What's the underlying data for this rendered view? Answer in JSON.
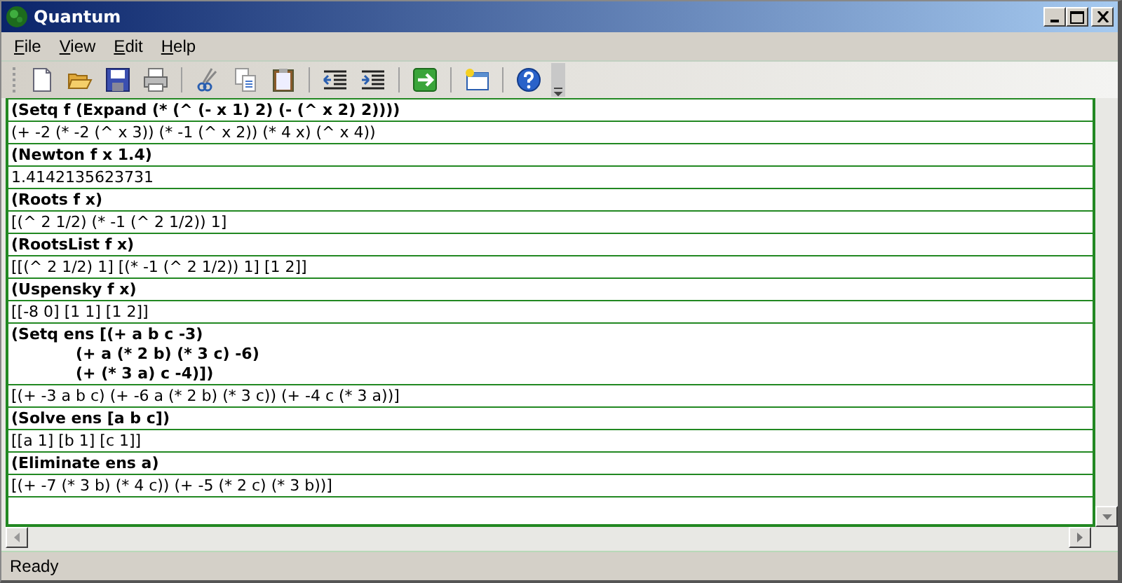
{
  "window": {
    "title": "Quantum"
  },
  "menu": [
    "File",
    "View",
    "Edit",
    "Help"
  ],
  "toolbar": [
    {
      "kind": "new"
    },
    {
      "kind": "open"
    },
    {
      "kind": "save"
    },
    {
      "kind": "print"
    },
    {
      "kind": "sep"
    },
    {
      "kind": "cut"
    },
    {
      "kind": "copy"
    },
    {
      "kind": "paste"
    },
    {
      "kind": "sep"
    },
    {
      "kind": "outdent"
    },
    {
      "kind": "indent"
    },
    {
      "kind": "sep"
    },
    {
      "kind": "run"
    },
    {
      "kind": "sep"
    },
    {
      "kind": "window"
    },
    {
      "kind": "sep"
    },
    {
      "kind": "help"
    }
  ],
  "entries": [
    {
      "kind": "input",
      "lines": [
        "(Setq f (Expand (* (^ (- x 1) 2) (- (^ x 2) 2))))"
      ]
    },
    {
      "kind": "output",
      "lines": [
        "(+ -2 (* -2 (^ x 3)) (* -1 (^ x 2)) (* 4 x) (^ x 4))"
      ]
    },
    {
      "kind": "input",
      "lines": [
        "(Newton f x 1.4)"
      ]
    },
    {
      "kind": "output",
      "lines": [
        "1.4142135623731"
      ]
    },
    {
      "kind": "input",
      "lines": [
        "(Roots f x)"
      ]
    },
    {
      "kind": "output",
      "lines": [
        "[(^ 2 1/2) (* -1 (^ 2 1/2)) 1]"
      ]
    },
    {
      "kind": "input",
      "lines": [
        "(RootsList f x)"
      ]
    },
    {
      "kind": "output",
      "lines": [
        "[[(^ 2 1/2) 1] [(* -1 (^ 2 1/2)) 1] [1 2]]"
      ]
    },
    {
      "kind": "input",
      "lines": [
        "(Uspensky f x)"
      ]
    },
    {
      "kind": "output",
      "lines": [
        "[[-8 0] [1 1] [1 2]]"
      ]
    },
    {
      "kind": "input",
      "lines": [
        "(Setq ens [(+ a b c -3)",
        "(+ a (* 2 b) (* 3 c) -6)",
        "(+ (* 3 a) c -4)])"
      ]
    },
    {
      "kind": "output",
      "lines": [
        "[(+ -3 a b c) (+ -6 a (* 2 b) (* 3 c)) (+ -4 c (* 3 a))]"
      ]
    },
    {
      "kind": "input",
      "lines": [
        "(Solve ens [a b c])"
      ]
    },
    {
      "kind": "output",
      "lines": [
        "[[a 1] [b 1] [c 1]]"
      ]
    },
    {
      "kind": "input",
      "lines": [
        "(Eliminate ens a)"
      ]
    },
    {
      "kind": "output",
      "lines": [
        "[(+ -7 (* 3 b) (* 4 c)) (+ -5 (* 2 c) (* 3 b))]"
      ]
    }
  ],
  "status_bar": "Ready"
}
